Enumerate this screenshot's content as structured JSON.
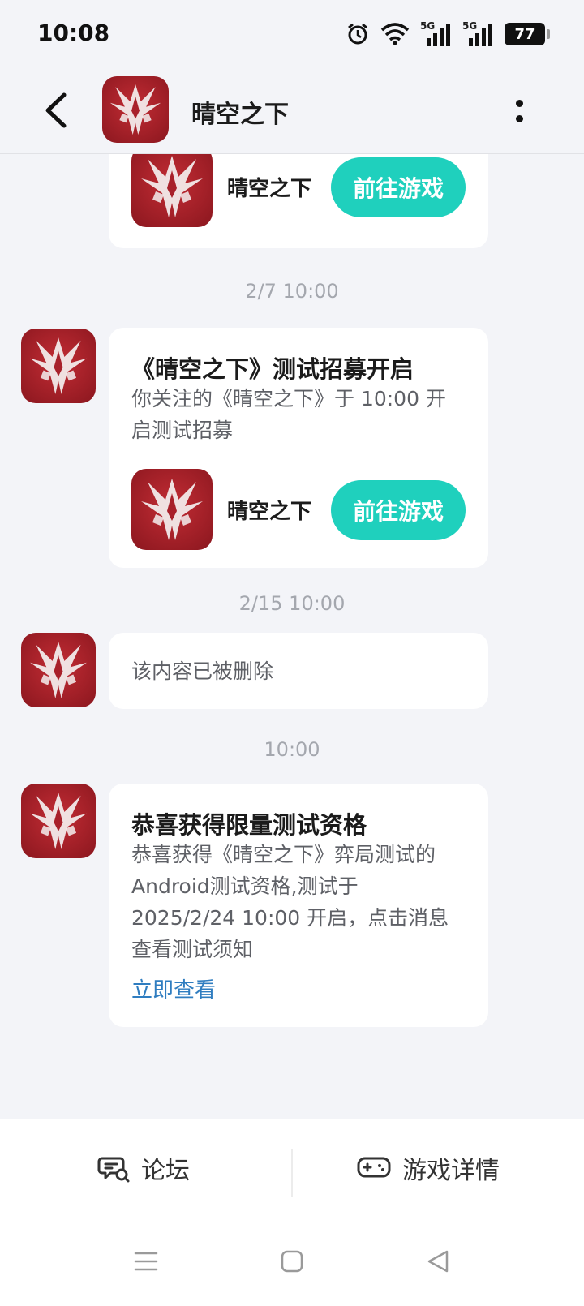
{
  "status": {
    "time": "10:08",
    "battery": "77",
    "network_1": "5G",
    "network_2": "5G"
  },
  "header": {
    "title": "晴空之下"
  },
  "game": {
    "name": "晴空之下",
    "button_label": "前往游戏"
  },
  "messages": [
    {
      "time": "2/7  10:00",
      "title": "《晴空之下》测试招募开启",
      "text": "你关注的《晴空之下》于 10:00 开启测试招募"
    },
    {
      "time": "2/15  10:00",
      "text": "该内容已被删除"
    },
    {
      "time": "10:00",
      "title": "恭喜获得限量测试资格",
      "text": "恭喜获得《晴空之下》弈局测试的Android测试资格,测试于2025/2/24 10:00 开启，点击消息查看测试须知",
      "link": "立即查看"
    }
  ],
  "bottom_nav": {
    "forum": "论坛",
    "game_detail": "游戏详情"
  },
  "colors": {
    "accent": "#1fd0bd",
    "link": "#2f7dc0",
    "icon_red": "#a8202a",
    "background": "#f3f4f8"
  }
}
